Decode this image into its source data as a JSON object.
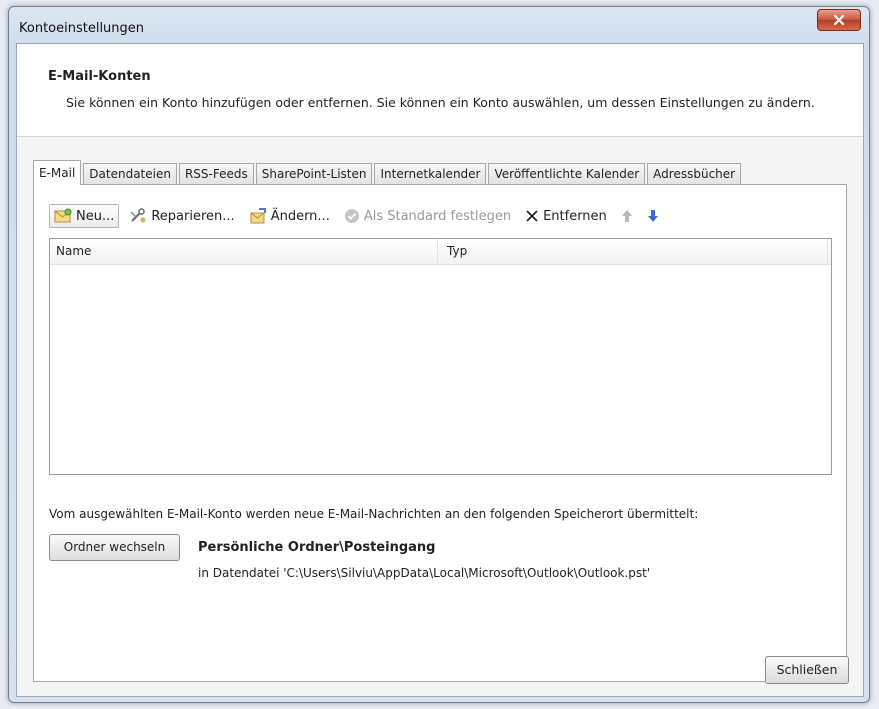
{
  "window": {
    "title": "Kontoeinstellungen",
    "close_symbol": "x"
  },
  "header": {
    "title": "E-Mail-Konten",
    "description": "Sie können ein Konto hinzufügen oder entfernen. Sie können ein Konto auswählen, um dessen Einstellungen zu ändern."
  },
  "tabs": [
    {
      "label": "E-Mail",
      "active": true
    },
    {
      "label": "Datendateien",
      "active": false
    },
    {
      "label": "RSS-Feeds",
      "active": false
    },
    {
      "label": "SharePoint-Listen",
      "active": false
    },
    {
      "label": "Internetkalender",
      "active": false
    },
    {
      "label": "Veröffentlichte Kalender",
      "active": false
    },
    {
      "label": "Adressbücher",
      "active": false
    }
  ],
  "toolbar": {
    "new_label": "Neu...",
    "repair_label": "Reparieren...",
    "change_label": "Ändern...",
    "default_label": "Als Standard festlegen",
    "remove_label": "Entfernen"
  },
  "account_list": {
    "columns": [
      "Name",
      "Typ"
    ],
    "rows": []
  },
  "delivery": {
    "info": "Vom ausgewählten E-Mail-Konto werden neue E-Mail-Nachrichten an den folgenden Speicherort übermittelt:",
    "change_folder_label": "Ordner wechseln",
    "folder": "Persönliche Ordner\\Posteingang",
    "path": "in Datendatei 'C:\\Users\\Silviu\\AppData\\Local\\Microsoft\\Outlook\\Outlook.pst'"
  },
  "footer": {
    "close_label": "Schließen"
  },
  "colors": {
    "close_button": "#c8523a",
    "arrow_up_disabled": "#b8b8b8",
    "arrow_down": "#3a6fd1"
  }
}
